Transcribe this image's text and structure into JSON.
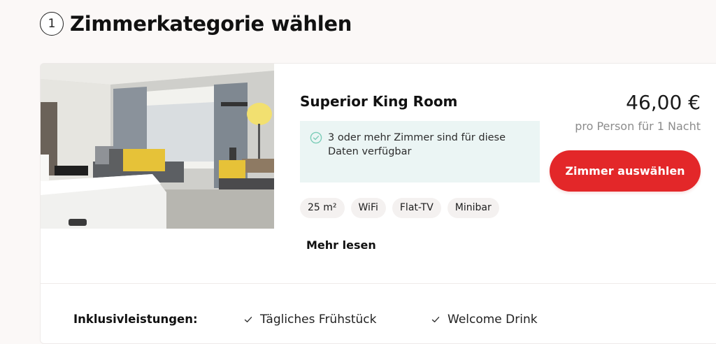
{
  "step": {
    "number": "1",
    "title": "Zimmerkategorie wählen"
  },
  "room": {
    "name": "Superior King Room",
    "availability": "3 oder mehr Zimmer sind für diese Daten verfügbar",
    "amenities": [
      "25 m²",
      "WiFi",
      "Flat-TV",
      "Minibar"
    ],
    "read_more": "Mehr lesen",
    "image_icon": "hotel-room-photo"
  },
  "pricing": {
    "price": "46,00 €",
    "per": "pro Person für 1 Nacht",
    "button_label": "Zimmer auswählen"
  },
  "inclusions": {
    "label": "Inklusivleistungen:",
    "items": [
      "Tägliches Frühstück",
      "Welcome Drink"
    ]
  },
  "colors": {
    "accent": "#e32729",
    "availability_bg": "#ebf5f4",
    "availability_icon": "#7ccdb8",
    "pill_bg": "#f4f1f0"
  }
}
